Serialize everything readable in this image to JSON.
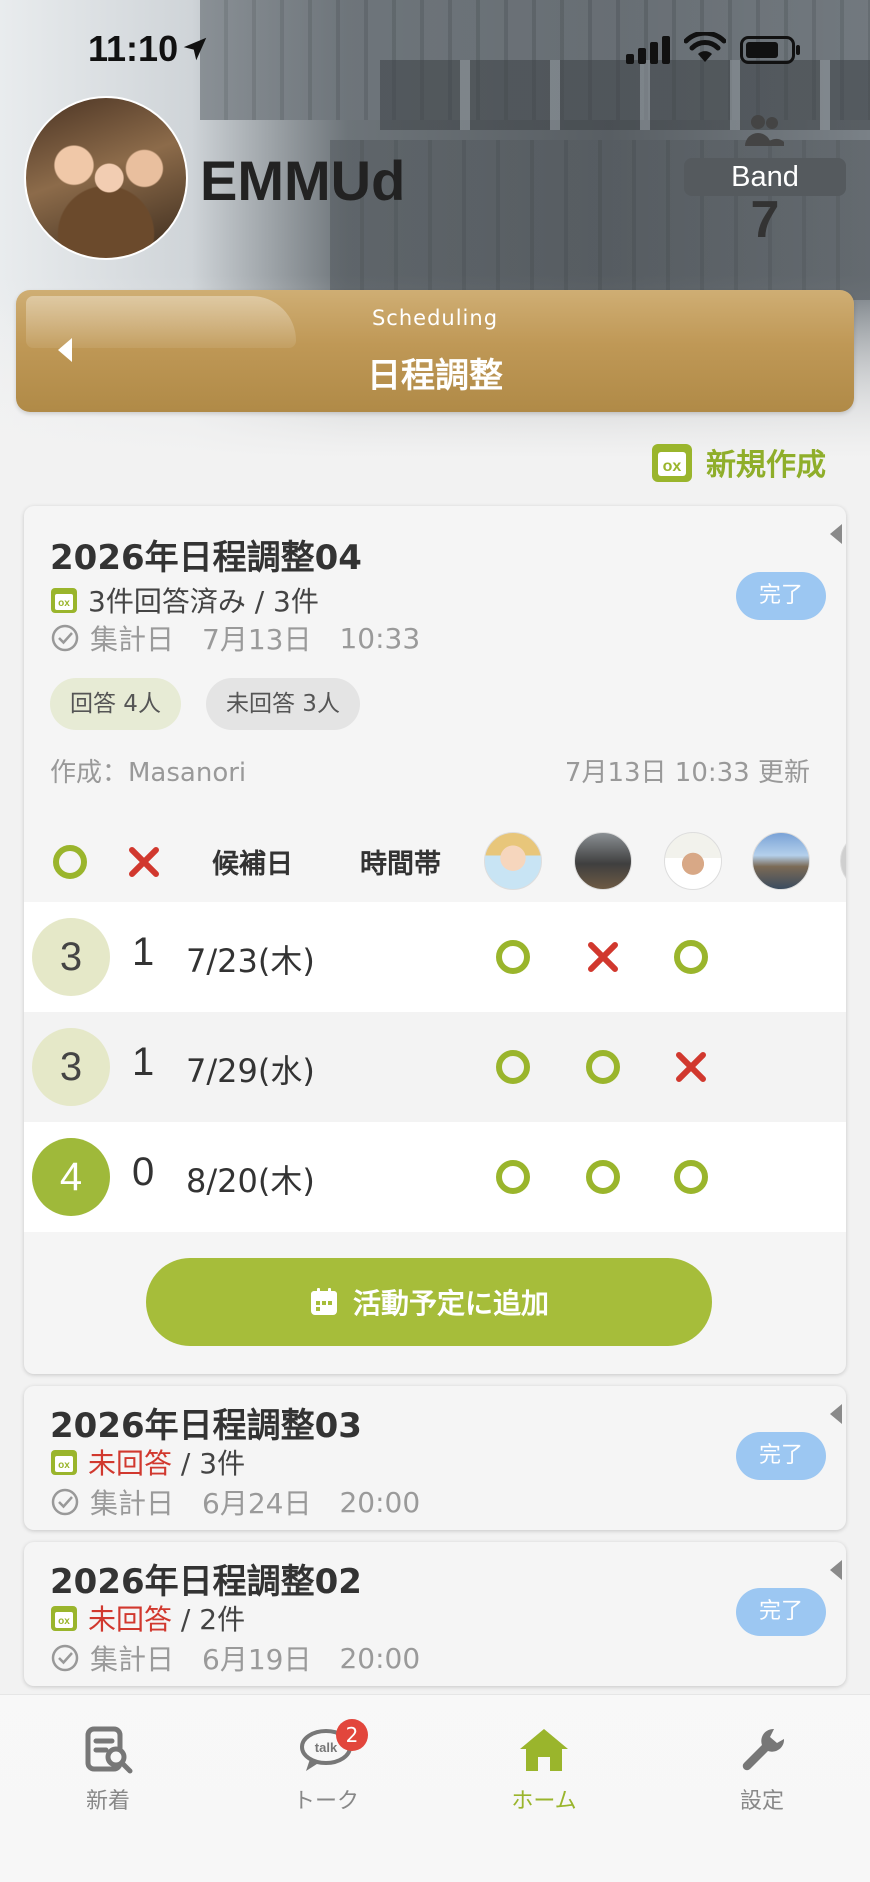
{
  "status_bar": {
    "time": "11:10"
  },
  "profile": {
    "band_name": "EMMUd",
    "badge_label": "Band",
    "member_count": "7"
  },
  "header": {
    "subtitle": "Scheduling",
    "title": "日程調整"
  },
  "new_button": {
    "label": "新規作成"
  },
  "cards": [
    {
      "title": "2026年日程調整04",
      "response_status": "3件回答済み / 3件",
      "tally_label": "集計日",
      "tally_date": "7月13日",
      "tally_time": "10:33",
      "status_badge": "完了",
      "answered_pill": "回答 4人",
      "unanswered_pill": "未回答 3人",
      "author": "作成：Masanori",
      "updated": "7月13日 10:33 更新",
      "table_headers": {
        "candidate_date": "候補日",
        "time_slot": "時間帯"
      },
      "rows": [
        {
          "yes_count": "3",
          "no_count": "1",
          "date": "7/23(木)",
          "marks": [
            "yes",
            "no",
            "yes"
          ]
        },
        {
          "yes_count": "3",
          "no_count": "1",
          "date": "7/29(水)",
          "marks": [
            "yes",
            "yes",
            "no"
          ]
        },
        {
          "yes_count": "4",
          "no_count": "0",
          "date": "8/20(木)",
          "marks": [
            "yes",
            "yes",
            "yes"
          ]
        }
      ],
      "add_button": "活動予定に追加"
    },
    {
      "title": "2026年日程調整03",
      "unanswered": "未回答",
      "total": " / 3件",
      "tally_label": "集計日",
      "tally_date": "6月24日",
      "tally_time": "20:00",
      "status_badge": "完了"
    },
    {
      "title": "2026年日程調整02",
      "unanswered": "未回答",
      "total": " / 2件",
      "tally_label": "集計日",
      "tally_date": "6月19日",
      "tally_time": "20:00",
      "status_badge": "完了"
    }
  ],
  "bottom_nav": [
    {
      "label": "新着",
      "icon": "news-search-icon"
    },
    {
      "label": "トーク",
      "icon": "talk-bubble-icon",
      "badge": "2"
    },
    {
      "label": "ホーム",
      "icon": "home-icon",
      "active": true
    },
    {
      "label": "設定",
      "icon": "wrench-icon"
    }
  ],
  "colors": {
    "accent_green": "#a6bd3a",
    "header_gold": "#bf9856",
    "done_blue": "#9cc7f2",
    "no_red": "#d1382e"
  }
}
